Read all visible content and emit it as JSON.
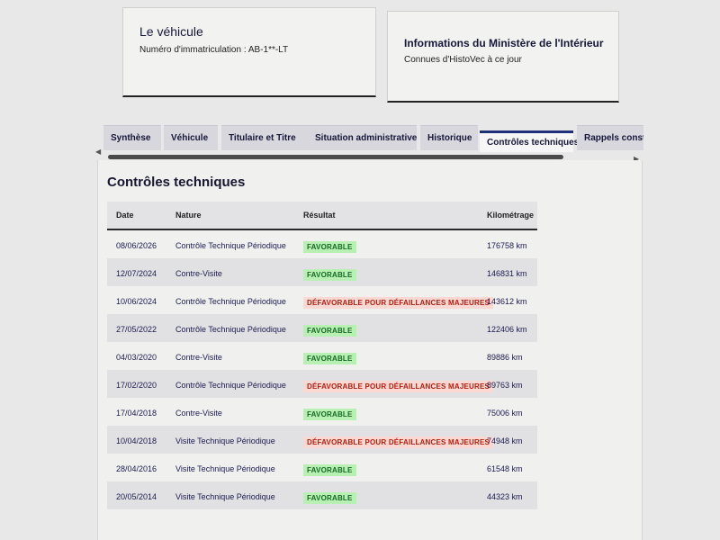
{
  "vehicle_card": {
    "title": "Le véhicule",
    "registration": "Numéro d'immatriculation : AB-1**-LT"
  },
  "ministry_card": {
    "title": "Informations du Ministère de l'Intérieur",
    "text": "Connues d'HistoVec à ce jour"
  },
  "tabs": [
    {
      "label": "Synthèse",
      "active": false
    },
    {
      "label": "Véhicule",
      "active": false
    },
    {
      "label": "Titulaire et Titre",
      "active": false
    },
    {
      "label": "Situation administrative",
      "active": false
    },
    {
      "label": "Historique",
      "active": false
    },
    {
      "label": "Contrôles techniques",
      "active": true
    },
    {
      "label": "Rappels constructeur",
      "active": false
    }
  ],
  "section": {
    "title": "Contrôles techniques"
  },
  "table": {
    "headers": {
      "date": "Date",
      "nature": "Nature",
      "result": "Résultat",
      "km": "Kilométrage"
    },
    "rows": [
      {
        "date": "08/06/2026",
        "nature": "Contrôle Technique Périodique",
        "result": "FAVORABLE",
        "status": "ok",
        "km": "176758 km"
      },
      {
        "date": "12/07/2024",
        "nature": "Contre-Visite",
        "result": "FAVORABLE",
        "status": "ok",
        "km": "146831 km"
      },
      {
        "date": "10/06/2024",
        "nature": "Contrôle Technique Périodique",
        "result": "DÉFAVORABLE POUR DÉFAILLANCES MAJEURES",
        "status": "ko",
        "km": "143612 km"
      },
      {
        "date": "27/05/2022",
        "nature": "Contrôle Technique Périodique",
        "result": "FAVORABLE",
        "status": "ok",
        "km": "122406 km"
      },
      {
        "date": "04/03/2020",
        "nature": "Contre-Visite",
        "result": "FAVORABLE",
        "status": "ok",
        "km": "89886 km"
      },
      {
        "date": "17/02/2020",
        "nature": "Contrôle Technique Périodique",
        "result": "DÉFAVORABLE POUR DÉFAILLANCES MAJEURES",
        "status": "ko",
        "km": "89763 km"
      },
      {
        "date": "17/04/2018",
        "nature": "Contre-Visite",
        "result": "FAVORABLE",
        "status": "ok",
        "km": "75006 km"
      },
      {
        "date": "10/04/2018",
        "nature": "Visite Technique Périodique",
        "result": "DÉFAVORABLE POUR DÉFAILLANCES MAJEURES",
        "status": "ko",
        "km": "74948 km"
      },
      {
        "date": "28/04/2016",
        "nature": "Visite Technique Périodique",
        "result": "FAVORABLE",
        "status": "ok",
        "km": "61548 km"
      },
      {
        "date": "20/05/2014",
        "nature": "Visite Technique Périodique",
        "result": "FAVORABLE",
        "status": "ok",
        "km": "44323 km"
      }
    ]
  },
  "colors": {
    "favorable_bg": "#b8f0b4",
    "favorable_text": "#166a22",
    "defavorable_bg": "#fcd8d2",
    "defavorable_text": "#b21e10",
    "active_tab_accent": "#1f2f7a"
  },
  "icons": {
    "scroll_left": "triangle-left-icon",
    "scroll_right": "triangle-right-icon"
  }
}
